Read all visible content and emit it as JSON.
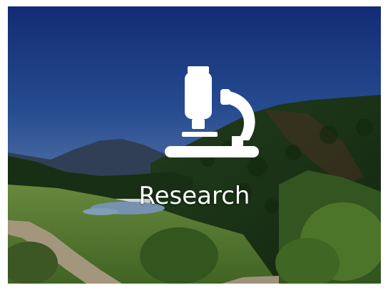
{
  "tile": {
    "label": "Research",
    "icon": "microscope-icon"
  },
  "colors": {
    "sky_top": "#1c3f9a",
    "sky_bottom": "#3f6fc0",
    "mountain": "#3c4f6e",
    "forest_dark": "#1f3a1c",
    "forest_mid": "#2f5a26",
    "meadow": "#6f9a3c",
    "lake": "#8fb4d8",
    "road": "#c9b79a",
    "icon": "#ffffff"
  }
}
